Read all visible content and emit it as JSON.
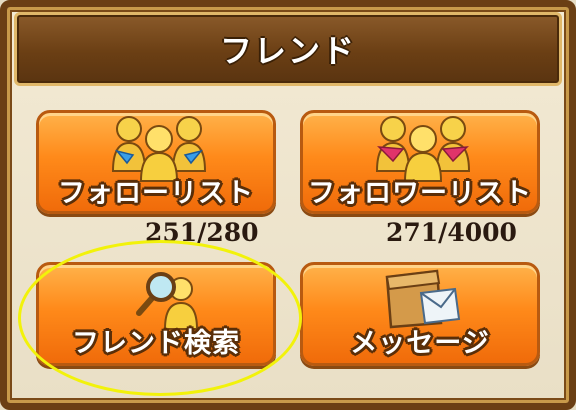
{
  "header": {
    "title": "フレンド"
  },
  "buttons": {
    "follow_list": {
      "label": "フォローリスト",
      "icon": "follow-people-icon"
    },
    "follower_list": {
      "label": "フォロワーリスト",
      "icon": "follower-people-icon"
    },
    "friend_search": {
      "label": "フレンド検索",
      "icon": "magnifier-person-icon"
    },
    "message": {
      "label": "メッセージ",
      "icon": "letter-box-icon"
    }
  },
  "counts": {
    "follow": "251/280",
    "follower": "271/4000"
  },
  "colors": {
    "button_orange": "#ff8a1a",
    "header_brown": "#6b3f14",
    "highlight_yellow": "#f2f20a"
  }
}
